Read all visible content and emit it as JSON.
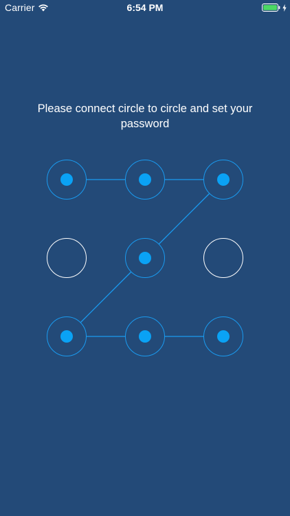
{
  "status_bar": {
    "carrier": "Carrier",
    "time": "6:54 PM",
    "wifi_icon": "wifi-icon",
    "battery_icon": "battery-full-icon",
    "charging_icon": "charging-bolt-icon",
    "battery_color": "#4cd964"
  },
  "prompt": {
    "text": "Please connect circle to circle and set your password"
  },
  "pattern": {
    "grid_size": 3,
    "nodes": [
      {
        "id": 1,
        "row": 0,
        "col": 0,
        "selected": true
      },
      {
        "id": 2,
        "row": 0,
        "col": 1,
        "selected": true
      },
      {
        "id": 3,
        "row": 0,
        "col": 2,
        "selected": true
      },
      {
        "id": 4,
        "row": 1,
        "col": 0,
        "selected": false
      },
      {
        "id": 5,
        "row": 1,
        "col": 1,
        "selected": true
      },
      {
        "id": 6,
        "row": 1,
        "col": 2,
        "selected": false
      },
      {
        "id": 7,
        "row": 2,
        "col": 0,
        "selected": true
      },
      {
        "id": 8,
        "row": 2,
        "col": 1,
        "selected": true
      },
      {
        "id": 9,
        "row": 2,
        "col": 2,
        "selected": true
      }
    ],
    "path": [
      1,
      2,
      3,
      5,
      7,
      8,
      9
    ],
    "colors": {
      "background": "#234a78",
      "selected_ring": "#1a9bf0",
      "selected_dot": "#0aa2f5",
      "unselected_ring": "#ffffff",
      "line": "#1a9bf0"
    }
  }
}
